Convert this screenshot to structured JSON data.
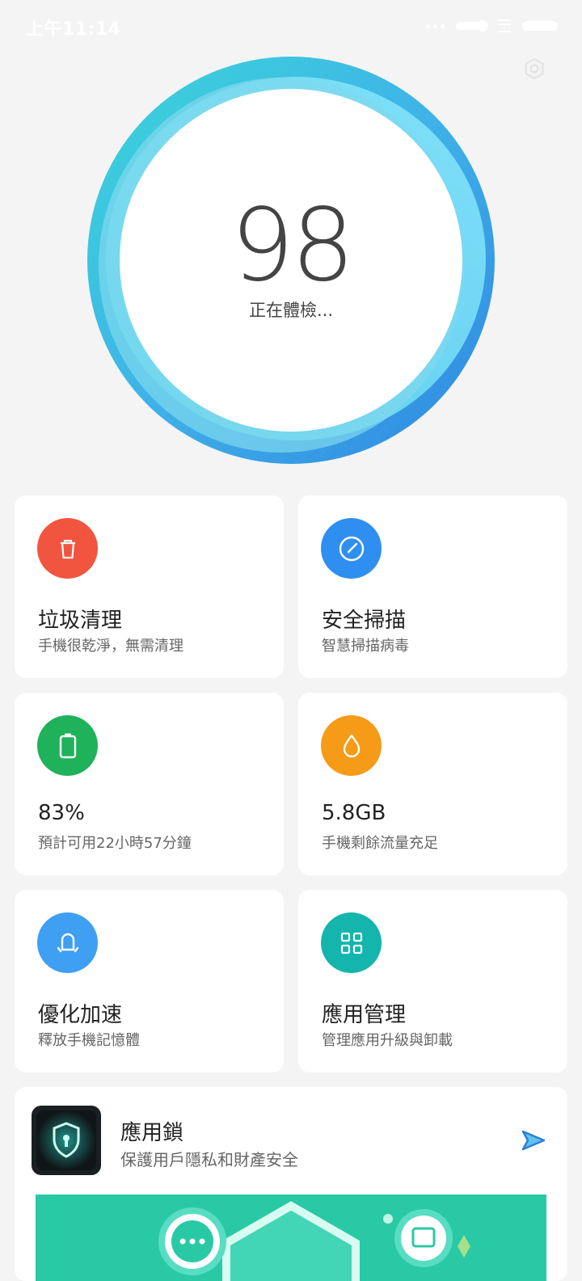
{
  "status_bar": {
    "time": "上午11:14"
  },
  "score": {
    "value": "98",
    "status": "正在體檢..."
  },
  "cards": [
    {
      "title": "垃圾清理",
      "subtitle": "手機很乾淨，無需清理",
      "color": "#f2553f"
    },
    {
      "title": "安全掃描",
      "subtitle": "智慧掃描病毒",
      "color": "#2f8ff0"
    },
    {
      "title": "83%",
      "subtitle": "預計可用22小時57分鐘",
      "color": "#1fb25a"
    },
    {
      "title": "5.8GB",
      "subtitle": "手機剩餘流量充足",
      "color": "#f59b18"
    },
    {
      "title": "優化加速",
      "subtitle": "釋放手機記憶體",
      "color": "#3f9ff2"
    },
    {
      "title": "應用管理",
      "subtitle": "管理應用升級與卸載",
      "color": "#13b5ad"
    }
  ],
  "app_lock": {
    "title": "應用鎖",
    "subtitle": "保護用戶隱私和財產安全",
    "banner_color": "#2ac9a6"
  },
  "icons": {
    "trash": "trash-icon",
    "scan": "scan-gauge-icon",
    "battery": "battery-icon",
    "data": "droplet-icon",
    "boost": "bell-boost-icon",
    "apps": "grid-apps-icon",
    "settings": "gear-icon",
    "lock": "shield-lock-icon",
    "go": "send-arrow-icon"
  }
}
